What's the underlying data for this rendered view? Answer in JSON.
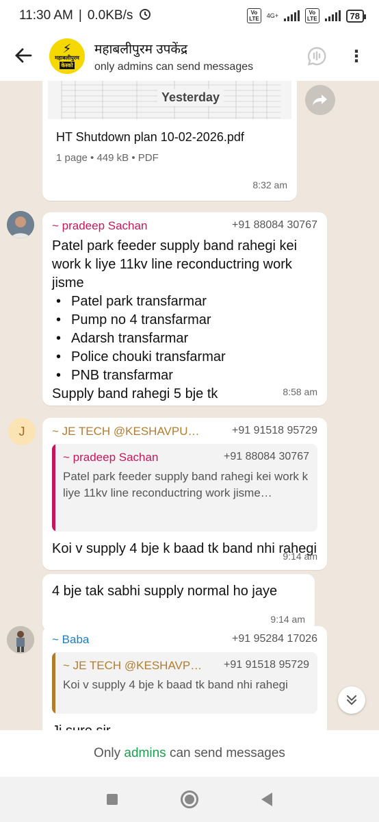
{
  "status_bar": {
    "time": "11:30 AM",
    "network_speed": "0.0KB/s",
    "alarm_icon": "alarm-icon",
    "sim1": "Vo LTE",
    "sim2_type": "4G+",
    "sim2": "Vo LTE",
    "battery": "78"
  },
  "header": {
    "title": "महाबलीपुरम उपकेंद्र",
    "subtitle": "only admins can send messages",
    "logo_text": "महाबलीपुरम",
    "logo_subtext": "केस्को"
  },
  "messages": {
    "pdf": {
      "date_overlay": "Yesterday",
      "filename": "HT Shutdown plan 10-02-2026.pdf",
      "meta": "1 page • 449 kB • PDF",
      "time": "8:32 am"
    },
    "msg1": {
      "sender": "~ pradeep Sachan",
      "phone": "+91 88084 30767",
      "text": "Patel park feeder supply band rahegi kei work k liye 11kv line reconductring work jisme",
      "bullets": [
        "Patel park transfarmar",
        "Pump no 4 transfarmar",
        "Adarsh transfarmar",
        "Police chouki transfarmar",
        "PNB transfarmar"
      ],
      "closing": "Supply band rahegi 5 bje tk",
      "time": "8:58 am"
    },
    "msg2": {
      "avatar_letter": "J",
      "sender": "~ JE TECH @KESHAVPU…",
      "phone": "+91 91518 95729",
      "quote_sender": "~ pradeep Sachan",
      "quote_phone": "+91 88084 30767",
      "quote_text": "Patel park feeder supply band rahegi kei work k liye 11kv line reconductring work jisme…",
      "text": "Koi v supply 4 bje k baad tk band nhi rahegi",
      "time": "9:14 am"
    },
    "msg3": {
      "text": "4 bje tak sabhi supply normal ho jaye",
      "time": "9:14 am"
    },
    "msg4": {
      "sender": "~ Baba",
      "phone": "+91 95284 17026",
      "quote_sender": "~ JE TECH @KESHAVP…",
      "quote_phone": "+91 91518 95729",
      "quote_text": "Koi v supply 4 bje k baad tk band nhi rahegi",
      "text": "Ji sure sir"
    }
  },
  "footer": {
    "prefix": "Only",
    "admins": "admins",
    "suffix": "can send messages"
  },
  "colors": {
    "pradeep": "#c2185b",
    "je_tech": "#b07d2e",
    "baba": "#1a7fc1",
    "admins_link": "#1d9e4e"
  }
}
